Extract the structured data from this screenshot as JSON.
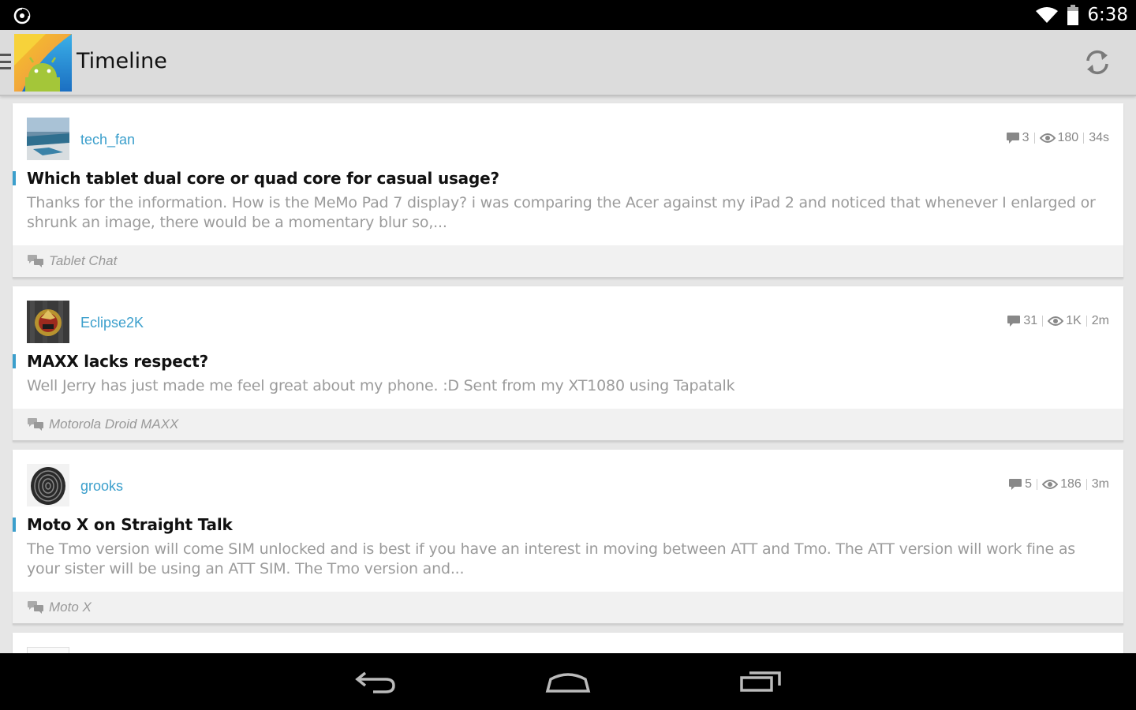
{
  "status_bar": {
    "time": "6:38",
    "left_icon": "moon-icon",
    "right_icons": [
      "wifi-icon",
      "battery-icon"
    ]
  },
  "header": {
    "title": "Timeline",
    "logo": "app-logo-android",
    "refresh_icon": "refresh-icon",
    "drawer_icon": "drawer-indicator-icon"
  },
  "accent_color": "#3b9fcc",
  "posts": [
    {
      "username": "tech_fan",
      "replies": "3",
      "views": "180",
      "time": "34s",
      "title": "Which tablet dual core or quad core for casual usage?",
      "excerpt": "Thanks for the information. How is the MeMo Pad 7 display? i was comparing the Acer against my iPad 2 and noticed that whenever I enlarged or shrunk an image, there would be a momentary blur so,...",
      "forum": "Tablet Chat"
    },
    {
      "username": "Eclipse2K",
      "replies": "31",
      "views": "1K",
      "time": "2m",
      "title": "MAXX lacks respect?",
      "excerpt": "Well Jerry has just made me feel great about my phone. :D Sent from my XT1080 using Tapatalk",
      "forum": "Motorola Droid MAXX"
    },
    {
      "username": "grooks",
      "replies": "5",
      "views": "186",
      "time": "3m",
      "title": "Moto X on Straight Talk",
      "excerpt": "The Tmo version will come SIM unlocked and is best if you have an interest in moving between ATT and Tmo. The ATT version will work fine as your sister will be using an ATT SIM. The Tmo version and...",
      "forum": "Moto X"
    }
  ],
  "nav_bar": {
    "back_icon": "back-icon",
    "home_icon": "home-icon",
    "recents_icon": "recents-icon"
  }
}
